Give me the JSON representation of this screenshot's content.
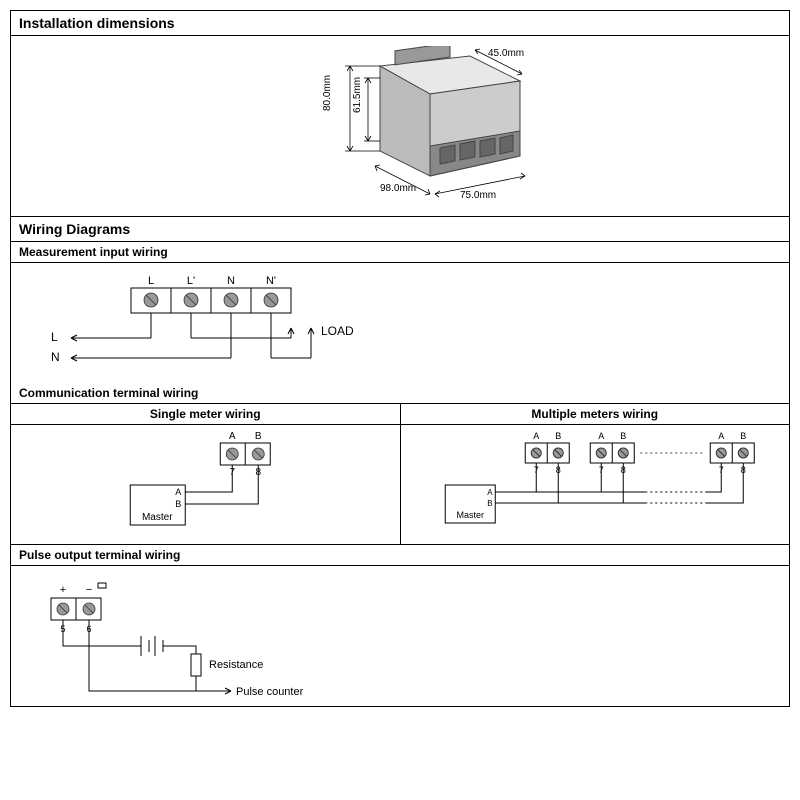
{
  "sections": {
    "install_dims": {
      "title": "Installation dimensions",
      "dims": {
        "top": "45.0mm",
        "height_outer": "80.0mm",
        "height_inner": "61.5mm",
        "front_width": "75.0mm",
        "depth": "98.0mm"
      }
    },
    "wiring": {
      "title": "Wiring Diagrams",
      "measurement": {
        "title": "Measurement input wiring",
        "terminals": [
          "L",
          "L'",
          "N",
          "N'"
        ],
        "inputs": {
          "L": "L",
          "N": "N"
        },
        "load": "LOAD"
      },
      "communication": {
        "title": "Communication terminal wiring",
        "single": {
          "title": "Single meter wiring",
          "term_labels": [
            "A",
            "B"
          ],
          "term_nums": [
            "7",
            "8"
          ],
          "master": "Master",
          "master_a": "A",
          "master_b": "B"
        },
        "multiple": {
          "title": "Multiple meters wiring",
          "term_labels": [
            "A",
            "B"
          ],
          "term_nums": [
            "7",
            "8"
          ],
          "master": "Master",
          "master_a": "A",
          "master_b": "B"
        }
      },
      "pulse": {
        "title": "Pulse output terminal wiring",
        "plus": "+",
        "minus": "−",
        "term_nums": [
          "5",
          "6"
        ],
        "resistance": "Resistance",
        "counter": "Pulse counter"
      }
    }
  }
}
